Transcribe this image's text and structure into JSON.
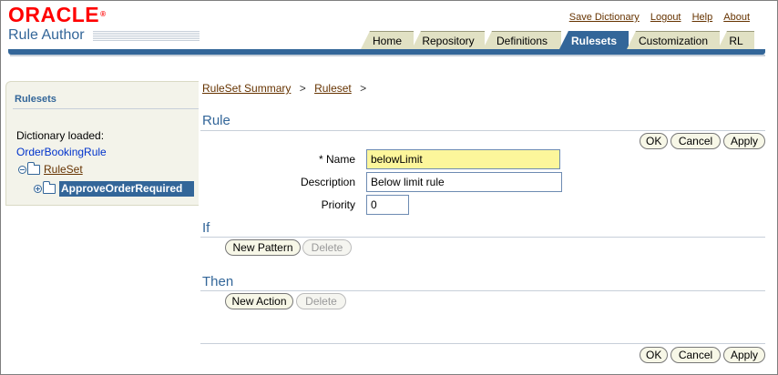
{
  "header": {
    "brand": "ORACLE",
    "brand_mark": "®",
    "app_title": "Rule Author",
    "global_links": [
      "Save Dictionary",
      "Logout",
      "Help",
      "About"
    ]
  },
  "tabs": [
    {
      "label": "Home",
      "active": false
    },
    {
      "label": "Repository",
      "active": false
    },
    {
      "label": "Definitions",
      "active": false
    },
    {
      "label": "Rulesets",
      "active": true
    },
    {
      "label": "Customization",
      "active": false
    },
    {
      "label": "RL",
      "active": false
    }
  ],
  "sidebar": {
    "heading": "Rulesets",
    "dictionary_label": "Dictionary loaded:",
    "dictionary_name": "OrderBookingRule",
    "tree": {
      "ruleset_label": "RuleSet",
      "rule_label": "ApproveOrderRequired"
    }
  },
  "breadcrumb": {
    "items": [
      "RuleSet Summary",
      "Ruleset"
    ],
    "separator": ">"
  },
  "rule_section": {
    "title": "Rule",
    "buttons": {
      "ok": "OK",
      "cancel": "Cancel",
      "apply": "Apply"
    },
    "fields": {
      "name_label": "* Name",
      "name_value": "belowLimit",
      "description_label": "Description",
      "description_value": "Below limit rule",
      "priority_label": "Priority",
      "priority_value": "0"
    }
  },
  "if_section": {
    "title": "If",
    "new_button": "New Pattern",
    "delete_button": "Delete"
  },
  "then_section": {
    "title": "Then",
    "new_button": "New Action",
    "delete_button": "Delete"
  },
  "footer_buttons": {
    "ok": "OK",
    "cancel": "Cancel",
    "apply": "Apply"
  },
  "colors": {
    "brand_red": "#ff0000",
    "accent_blue": "#336699",
    "link_brown": "#663300",
    "required_yellow": "#fcf69b"
  }
}
